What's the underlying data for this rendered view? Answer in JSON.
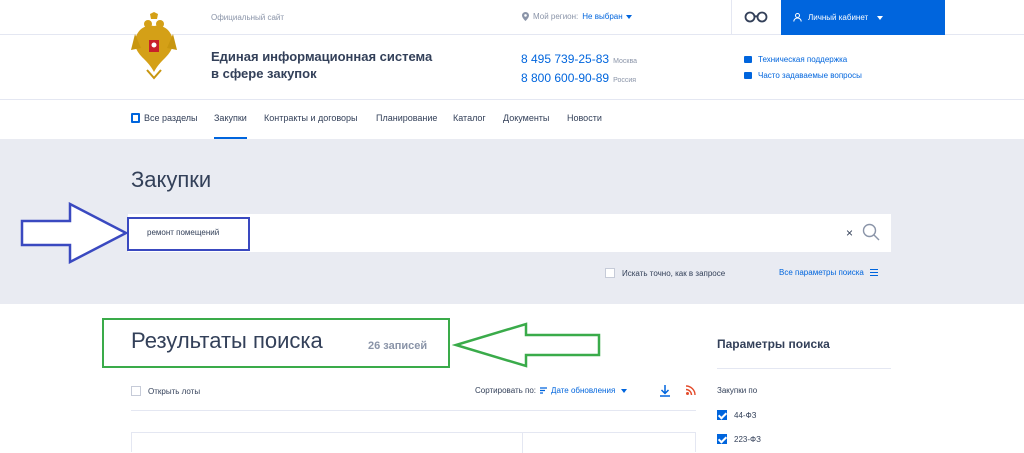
{
  "header": {
    "official_site": "Официальный сайт",
    "region_label": "Мой регион:",
    "region_value": "Не выбран",
    "cabinet_label": "Личный кабинет",
    "site_title_line1": "Единая информационная система",
    "site_title_line2": "в сфере закупок",
    "phones": [
      {
        "number": "8 495 739-25-83",
        "city": "Москва"
      },
      {
        "number": "8 800 600-90-89",
        "city": "Россия"
      }
    ],
    "support_links": [
      {
        "label": "Техническая поддержка",
        "icon": "envelope-icon"
      },
      {
        "label": "Часто задаваемые вопросы",
        "icon": "faq-icon"
      }
    ]
  },
  "nav": {
    "items": [
      {
        "label": "Все разделы"
      },
      {
        "label": "Закупки",
        "active": true
      },
      {
        "label": "Контракты и договоры"
      },
      {
        "label": "Планирование"
      },
      {
        "label": "Каталог"
      },
      {
        "label": "Документы"
      },
      {
        "label": "Новости"
      }
    ]
  },
  "search": {
    "page_title": "Закупки",
    "query": "ремонт помещений",
    "exact_match_label": "Искать точно, как в запросе",
    "all_params_label": "Все параметры поиска"
  },
  "results": {
    "title": "Результаты поиска",
    "count": "26 записей",
    "open_lots_label": "Открыть лоты",
    "sort_label": "Сортировать по:",
    "sort_value": "Дате обновления"
  },
  "params": {
    "title": "Параметры поиска",
    "purchases_by": "Закупки по",
    "laws": [
      {
        "label": "44-ФЗ",
        "checked": true
      },
      {
        "label": "223-ФЗ",
        "checked": true
      }
    ]
  },
  "colors": {
    "accent": "#0065dd",
    "highlight_blue": "#3a49c0",
    "highlight_green": "#3aab4a"
  }
}
